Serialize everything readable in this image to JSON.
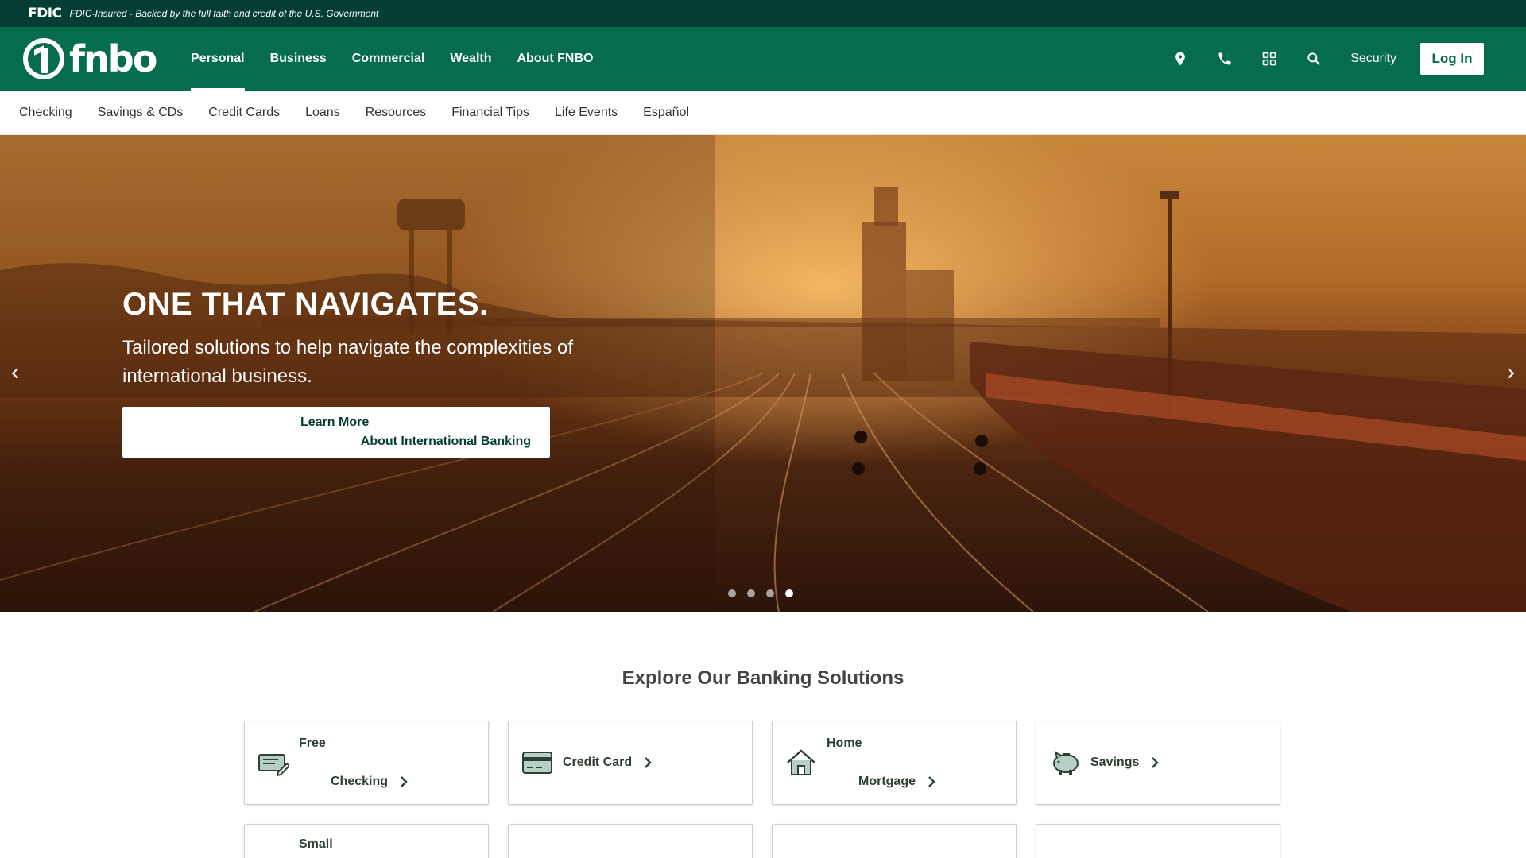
{
  "fdic": {
    "logo": "FDIC",
    "text": "FDIC-Insured - Backed by the full faith and credit of the U.S. Government"
  },
  "header": {
    "brand": "fnbo",
    "nav": [
      {
        "label": "Personal",
        "active": true
      },
      {
        "label": "Business",
        "active": false
      },
      {
        "label": "Commercial",
        "active": false
      },
      {
        "label": "Wealth",
        "active": false
      },
      {
        "label": "About FNBO",
        "active": false
      }
    ],
    "icons": [
      "location-pin-icon",
      "phone-icon",
      "app-grid-icon",
      "search-icon"
    ],
    "security_label": "Security",
    "login_label": "Log In"
  },
  "subnav": [
    "Checking",
    "Savings & CDs",
    "Credit Cards",
    "Loans",
    "Resources",
    "Financial Tips",
    "Life Events",
    "Español"
  ],
  "hero": {
    "title_strong": "ONE",
    "title_rest": " THAT NAVIGATES.",
    "subtitle": "Tailored solutions to help navigate the complexities of international business.",
    "cta_line1": "Learn More",
    "cta_line2": "About International Banking",
    "slides_total": 4,
    "active_slide": 4
  },
  "explore": {
    "title": "Explore Our Banking Solutions",
    "cards": [
      {
        "line1": "Free",
        "line2": "Checking",
        "icon": "checkbook-icon"
      },
      {
        "line1": "Credit Card",
        "line2": "",
        "icon": "credit-card-icon"
      },
      {
        "line1": "Home",
        "line2": "Mortgage",
        "icon": "house-icon"
      },
      {
        "line1": "Savings",
        "line2": "",
        "icon": "piggy-bank-icon"
      },
      {
        "line1": "Small",
        "line2": "",
        "icon": "business-icon"
      }
    ]
  },
  "colors": {
    "fdic_bar": "#033d33",
    "header": "#066c4e",
    "accent_text": "#033d33",
    "icon_fill": "#4f7a6a"
  }
}
